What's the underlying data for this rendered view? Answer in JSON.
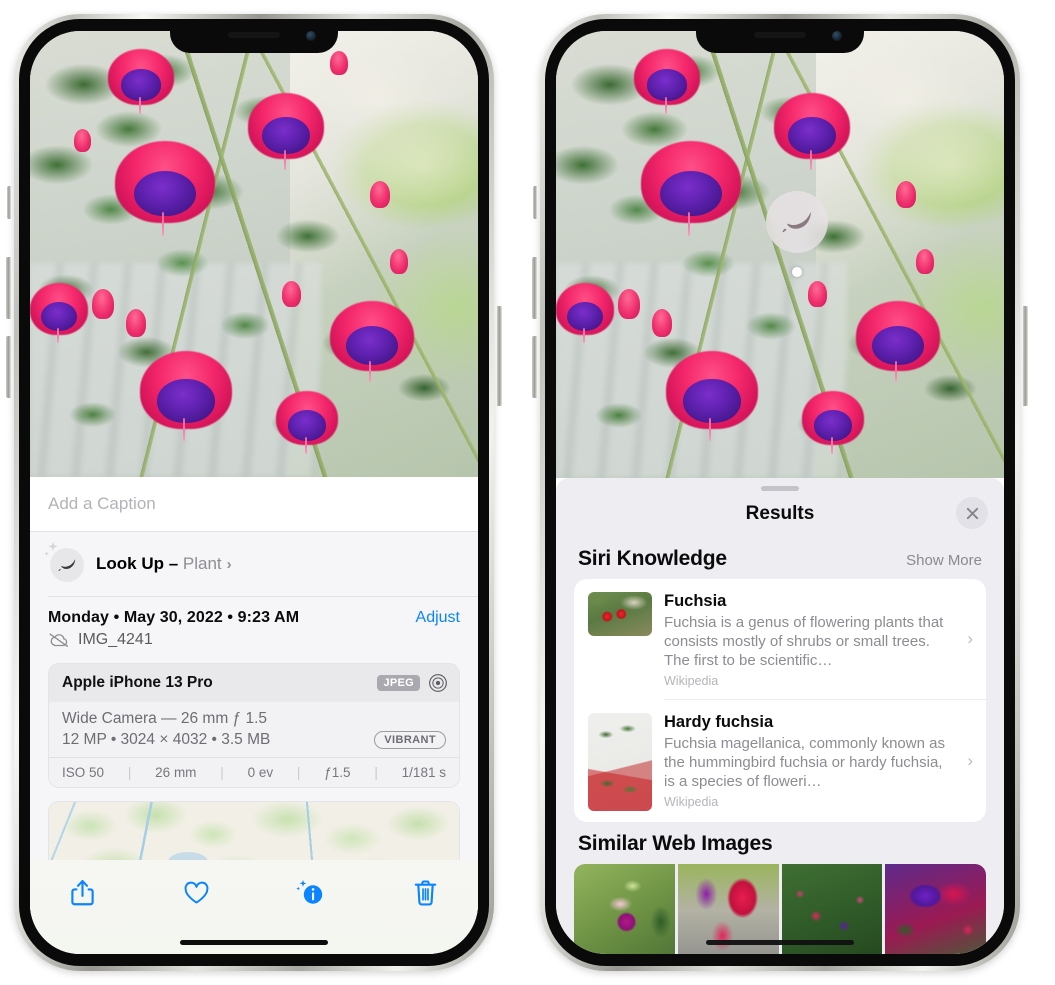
{
  "left_phone": {
    "photo": {
      "alt": "Fuchsia flowers hanging basket on porch"
    },
    "caption_field": {
      "placeholder": "Add a Caption",
      "value": ""
    },
    "lookup_row": {
      "icon": "leaf-icon",
      "sparkle_icon": "sparkles-icon",
      "label": "Look Up – ",
      "subject": "Plant",
      "chevron": "›"
    },
    "date_row": {
      "date_text": "Monday • May 30, 2022 • 9:23 AM",
      "adjust_label": "Adjust"
    },
    "file_row": {
      "icon": "cloud-slash-icon",
      "filename": "IMG_4241"
    },
    "camera_card": {
      "model": "Apple iPhone 13 Pro",
      "format_chip": "JPEG",
      "aperture_icon": "aperture-icon",
      "lens_line": "Wide Camera — 26 mm ƒ 1.5",
      "specs_line": "12 MP • 3024 × 4032 • 3.5 MB",
      "style_chip": "VIBRANT",
      "exif": [
        "ISO 50",
        "26 mm",
        "0 ev",
        "ƒ1.5",
        "1/181 s"
      ]
    },
    "toolbar": {
      "share_label": "share-icon",
      "favorite_label": "heart-icon",
      "info_label": "info-sparkle-icon",
      "delete_label": "trash-icon"
    }
  },
  "right_phone": {
    "visual_lookup_badge": {
      "icon": "leaf-icon"
    },
    "sheet": {
      "title": "Results",
      "close_label": "✕",
      "sections": [
        {
          "title": "Siri Knowledge",
          "action": "Show More",
          "items": [
            {
              "title": "Fuchsia",
              "description": "Fuchsia is a genus of flowering plants that consists mostly of shrubs or small trees. The first to be scientific…",
              "source": "Wikipedia",
              "chevron": "›"
            },
            {
              "title": "Hardy fuchsia",
              "description": "Fuchsia magellanica, commonly known as the hummingbird fuchsia or hardy fuchsia, is a species of floweri…",
              "source": "Wikipedia",
              "chevron": "›"
            }
          ]
        },
        {
          "title": "Similar Web Images",
          "images": [
            "fuchsia-web-image-1",
            "fuchsia-web-image-2",
            "fuchsia-web-image-3",
            "fuchsia-web-image-4"
          ]
        }
      ]
    }
  },
  "colors": {
    "accent_blue": "#0a84ff",
    "sheet_bg": "#eeedf2",
    "card_bg": "#ffffff",
    "secondary_text": "#8c8c92"
  }
}
